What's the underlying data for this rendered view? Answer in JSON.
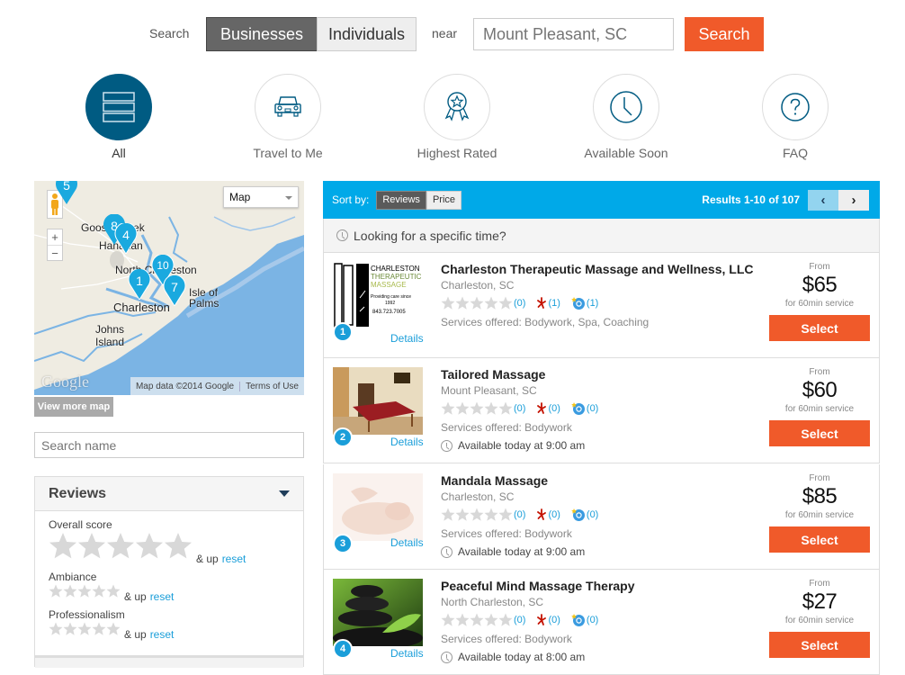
{
  "search": {
    "label": "Search",
    "toggle_businesses": "Businesses",
    "toggle_individuals": "Individuals",
    "active_toggle": "Businesses",
    "near_label": "near",
    "location_placeholder": "Mount Pleasant, SC",
    "button_label": "Search"
  },
  "categories": [
    {
      "label": "All",
      "icon": "list-icon",
      "active": true
    },
    {
      "label": "Travel to Me",
      "icon": "car-icon",
      "active": false
    },
    {
      "label": "Highest Rated",
      "icon": "award-ribbon-icon",
      "active": false
    },
    {
      "label": "Available Soon",
      "icon": "clock-icon",
      "active": false
    },
    {
      "label": "FAQ",
      "icon": "question-icon",
      "active": false
    }
  ],
  "map": {
    "type_selected": "Map",
    "place_labels": [
      "Goose Creek",
      "Hanahan",
      "North Charleston",
      "Charleston",
      "Isle of Palms",
      "Johns Island"
    ],
    "markers": [
      "5",
      "8",
      "4",
      "10",
      "1",
      "7"
    ],
    "attribution": "Map data ©2014 Google",
    "terms": "Terms of Use",
    "logo": "Google",
    "view_more": "View more map"
  },
  "name_search": {
    "placeholder": "Search name"
  },
  "reviews_filter": {
    "title": "Reviews",
    "groups": [
      {
        "label": "Overall score",
        "up": "& up",
        "reset": "reset"
      },
      {
        "label": "Ambiance",
        "up": "& up",
        "reset": "reset"
      },
      {
        "label": "Professionalism",
        "up": "& up",
        "reset": "reset"
      }
    ]
  },
  "results": {
    "sort_label": "Sort by:",
    "sort_options": [
      "Reviews",
      "Price"
    ],
    "sort_active": "Reviews",
    "count_text": "Results 1-10 of 107",
    "specific_time": "Looking for a specific time?",
    "colors": {
      "accent": "#00a9e8",
      "select": "#f05a2a",
      "link": "#1a9ed9"
    },
    "listings": [
      {
        "number": "1",
        "name": "Charleston Therapeutic Massage and Wellness, LLC",
        "city": "Charleston, SC",
        "review_count": "(0)",
        "yelp_count": "(1)",
        "other_count": "(1)",
        "services": "Services offered: Bodywork, Spa, Coaching",
        "availability": "",
        "from": "From",
        "price": "$65",
        "per": "for 60min service",
        "select": "Select",
        "details": "Details",
        "logo_text": [
          "CHARLESTON",
          "THERAPEUTIC",
          "MASSAGE",
          "Providing care since",
          "1992",
          "843.723.7005"
        ]
      },
      {
        "number": "2",
        "name": "Tailored Massage",
        "city": "Mount Pleasant, SC",
        "review_count": "(0)",
        "yelp_count": "(0)",
        "other_count": "(0)",
        "services": "Services offered: Bodywork",
        "availability": "Available today at 9:00 am",
        "from": "From",
        "price": "$60",
        "per": "for 60min service",
        "select": "Select",
        "details": "Details"
      },
      {
        "number": "3",
        "name": "Mandala Massage",
        "city": "Charleston, SC",
        "review_count": "(0)",
        "yelp_count": "(0)",
        "other_count": "(0)",
        "services": "Services offered: Bodywork",
        "availability": "Available today at 9:00 am",
        "from": "From",
        "price": "$85",
        "per": "for 60min service",
        "select": "Select",
        "details": "Details"
      },
      {
        "number": "4",
        "name": "Peaceful Mind Massage Therapy",
        "city": "North Charleston, SC",
        "review_count": "(0)",
        "yelp_count": "(0)",
        "other_count": "(0)",
        "services": "Services offered: Bodywork",
        "availability": "Available today at 8:00 am",
        "from": "From",
        "price": "$27",
        "per": "for 60min service",
        "select": "Select",
        "details": "Details"
      }
    ]
  }
}
